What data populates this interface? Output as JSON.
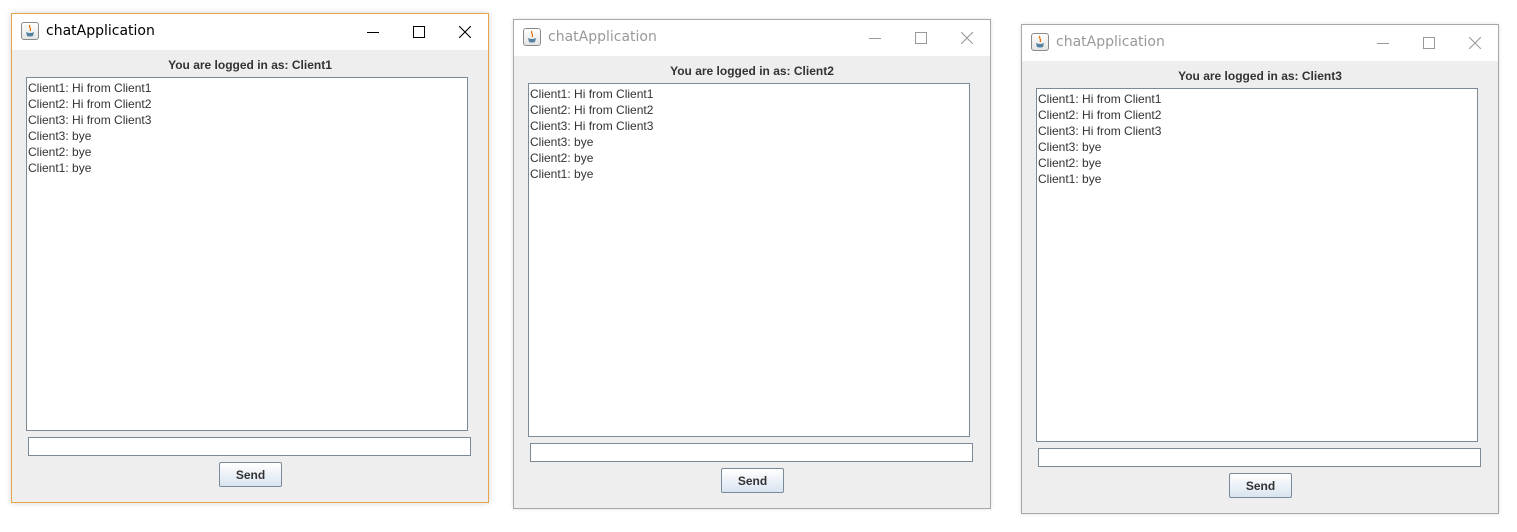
{
  "windows": [
    {
      "title": "chatApplication",
      "state": "active",
      "logged_in_label": "You are logged in as: Client1",
      "messages": [
        "Client1: Hi from Client1",
        "Client2: Hi from Client2",
        "Client3: Hi from Client3",
        "Client3: bye",
        "Client2: bye",
        "Client1: bye"
      ],
      "input_value": "",
      "send_label": "Send"
    },
    {
      "title": "chatApplication",
      "state": "inactive",
      "logged_in_label": "You are logged in as: Client2",
      "messages": [
        "Client1: Hi from Client1",
        "Client2: Hi from Client2",
        "Client3: Hi from Client3",
        "Client3: bye",
        "Client2: bye",
        "Client1: bye"
      ],
      "input_value": "",
      "send_label": "Send"
    },
    {
      "title": "chatApplication",
      "state": "inactive",
      "logged_in_label": "You are logged in as: Client3",
      "messages": [
        "Client1: Hi from Client1",
        "Client2: Hi from Client2",
        "Client3: Hi from Client3",
        "Client3: bye",
        "Client2: bye",
        "Client1: bye"
      ],
      "input_value": "",
      "send_label": "Send"
    }
  ],
  "icons": {
    "app": "java-icon",
    "minimize": "minimize-icon",
    "maximize": "maximize-icon",
    "close": "close-icon"
  },
  "colors": {
    "window_background": "#eeeeee",
    "titlebar": "#ffffff",
    "active_border": "#e7a54f",
    "inactive_title_text": "#999999",
    "field_border": "#7a8a99",
    "button_gradient_end": "#d9e4f0"
  }
}
